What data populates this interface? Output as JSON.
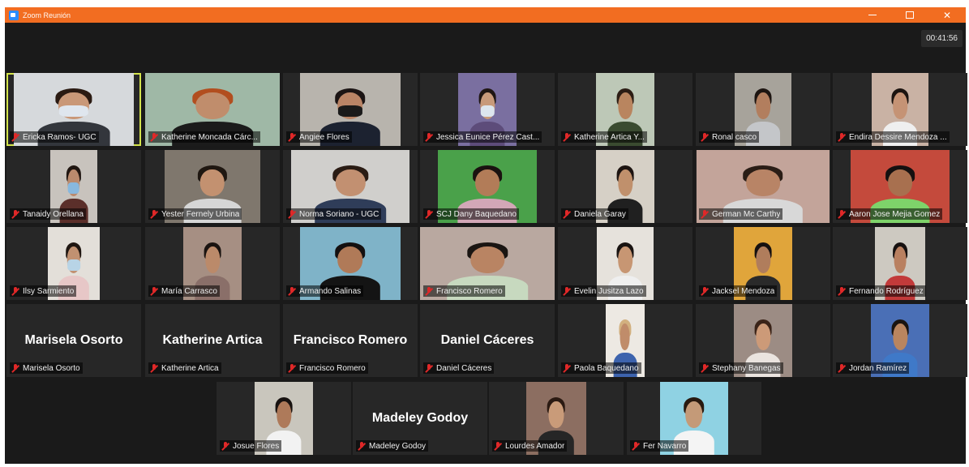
{
  "window": {
    "title": "Zoom Reunión",
    "timer": "00:41:56",
    "close_glyph": "✕"
  },
  "participants": [
    {
      "name": "Ericka Ramos- UGC",
      "active": true,
      "bg": "#d6d9dc",
      "skin": "#c99878",
      "hair": "#2a1a12",
      "shirt": "#33363c",
      "mask": "#dfe6ee"
    },
    {
      "name": "Katherine Moncada Cárc...",
      "bg": "#9fb8a6",
      "skin": "#c08d6c",
      "hair": "#b24e1f",
      "shirt": "#1b1b1b"
    },
    {
      "name": "Angiee Flores",
      "bg": "#b8b4ad",
      "skin": "#b98466",
      "hair": "#1b1414",
      "shirt": "#1c2230",
      "mask": "#1a1a1a"
    },
    {
      "name": "Jessica Eunice Pérez Cast...",
      "bg": "#7a6fa0",
      "skin": "#c89a7a",
      "hair": "#1f1613",
      "shirt": "#5d4c7a",
      "mask": "#dde6ee"
    },
    {
      "name": "Katherine Artica Y...",
      "bg": "#bdc8b7",
      "skin": "#b9855f",
      "hair": "#2c1d14",
      "shirt": "#3a4b30"
    },
    {
      "name": "Ronal casco",
      "bg": "#a7a39b",
      "skin": "#b27e5e",
      "hair": "#1d1511",
      "shirt": "#c4c6c9"
    },
    {
      "name": "Endira Dessire Mendoza ...",
      "bg": "#c9b2a4",
      "skin": "#c59375",
      "hair": "#1c1410",
      "shirt": "#efefef"
    },
    {
      "name": "Tanaidy Orellana",
      "bg": "#c8c3bd",
      "skin": "#ba8a6d",
      "hair": "#201611",
      "shirt": "#5b2f2a",
      "mask": "#88b8de"
    },
    {
      "name": "Yester Fernely Urbina",
      "bg": "#7f776d",
      "skin": "#c39170",
      "hair": "#1f1711",
      "shirt": "#d6d6d6"
    },
    {
      "name": "Norma Soriano - UGC",
      "bg": "#d0cfcc",
      "skin": "#c29071",
      "hair": "#2a1c14",
      "shirt": "#2f3d59"
    },
    {
      "name": "SCJ Dany Baquedano",
      "bg": "#4aa14a",
      "skin": "#b27c58",
      "hair": "#1a1210",
      "shirt": "#d2a7b7"
    },
    {
      "name": "Daniela Garay",
      "bg": "#d6d0c6",
      "skin": "#c0906c",
      "hair": "#1d1411",
      "shirt": "#202020"
    },
    {
      "name": "German Mc Carthy",
      "bg": "#c3a49a",
      "skin": "#b88466",
      "hair": "#2a1d16",
      "shirt": "#d8d8d8"
    },
    {
      "name": "Aaron Jose Mejia Gomez",
      "bg": "#c44a3c",
      "skin": "#a8704f",
      "hair": "#151010",
      "shirt": "#7ed36a"
    },
    {
      "name": "Ilsy Sarmiento",
      "bg": "#e3dfd9",
      "skin": "#c19171",
      "hair": "#1f1611",
      "shirt": "#e7c7c7",
      "mask": "#b8d4e6"
    },
    {
      "name": "María Carrasco",
      "bg": "#a68f83",
      "skin": "#bb8a6a",
      "hair": "#1a1310",
      "shirt": "#8a6f69"
    },
    {
      "name": "Armando Salinas",
      "bg": "#7fb3c8",
      "skin": "#b07a58",
      "hair": "#141010",
      "shirt": "#141414"
    },
    {
      "name": "Francisco Romero",
      "bg": "#b9a8a0",
      "skin": "#b98463",
      "hair": "#1a1512",
      "shirt": "#c7d9bf"
    },
    {
      "name": "Evelin Jusitza Lazo",
      "bg": "#e6e2dc",
      "skin": "#c79673",
      "hair": "#191311",
      "shirt": "#efefef"
    },
    {
      "name": "Jacksel Mendoza",
      "bg": "#e0a53b",
      "skin": "#b07d5c",
      "hair": "#161110",
      "shirt": "#2a2a2a"
    },
    {
      "name": "Fernando Rodríguez",
      "bg": "#cdc9c1",
      "skin": "#b98060",
      "hair": "#161110",
      "shirt": "#c23a3a"
    },
    {
      "name": "Marisela Osorto",
      "label": "Marisela Osorto"
    },
    {
      "name": "Katherine Artica",
      "label": "Katherine Artica"
    },
    {
      "name": "Francisco Romero",
      "label": "Francisco Romero"
    },
    {
      "name": "Daniel Cáceres",
      "label": "Daniel Cáceres"
    },
    {
      "name": "Paola Baquedano",
      "bg": "#ede9e3",
      "skin": "#c08c6a",
      "hair": "#d2b07f",
      "shirt": "#3d63ad"
    },
    {
      "name": "Stephany Banegas",
      "bg": "#9c8c84",
      "skin": "#cc9a78",
      "hair": "#3a2318",
      "shirt": "#eae4df"
    },
    {
      "name": "Jordan Ramírez",
      "bg": "#4a6fb6",
      "skin": "#b9855f",
      "hair": "#1a1410",
      "shirt": "#3f79c8"
    },
    {
      "name": "Josue Flores",
      "bg": "#c9c6bd",
      "skin": "#ae7a5a",
      "hair": "#171210",
      "shirt": "#f2f2f2"
    },
    {
      "name": "Madeley Godoy",
      "label": "Madeley Godoy"
    },
    {
      "name": "Lourdes Amador",
      "bg": "#8c6e61",
      "skin": "#c99b79",
      "hair": "#2b1a12",
      "shirt": "#262626"
    },
    {
      "name": "Fer Navarro",
      "bg": "#8fd2e3",
      "skin": "#c49a78",
      "hair": "#28190f",
      "shirt": "#f4f4f4"
    }
  ]
}
